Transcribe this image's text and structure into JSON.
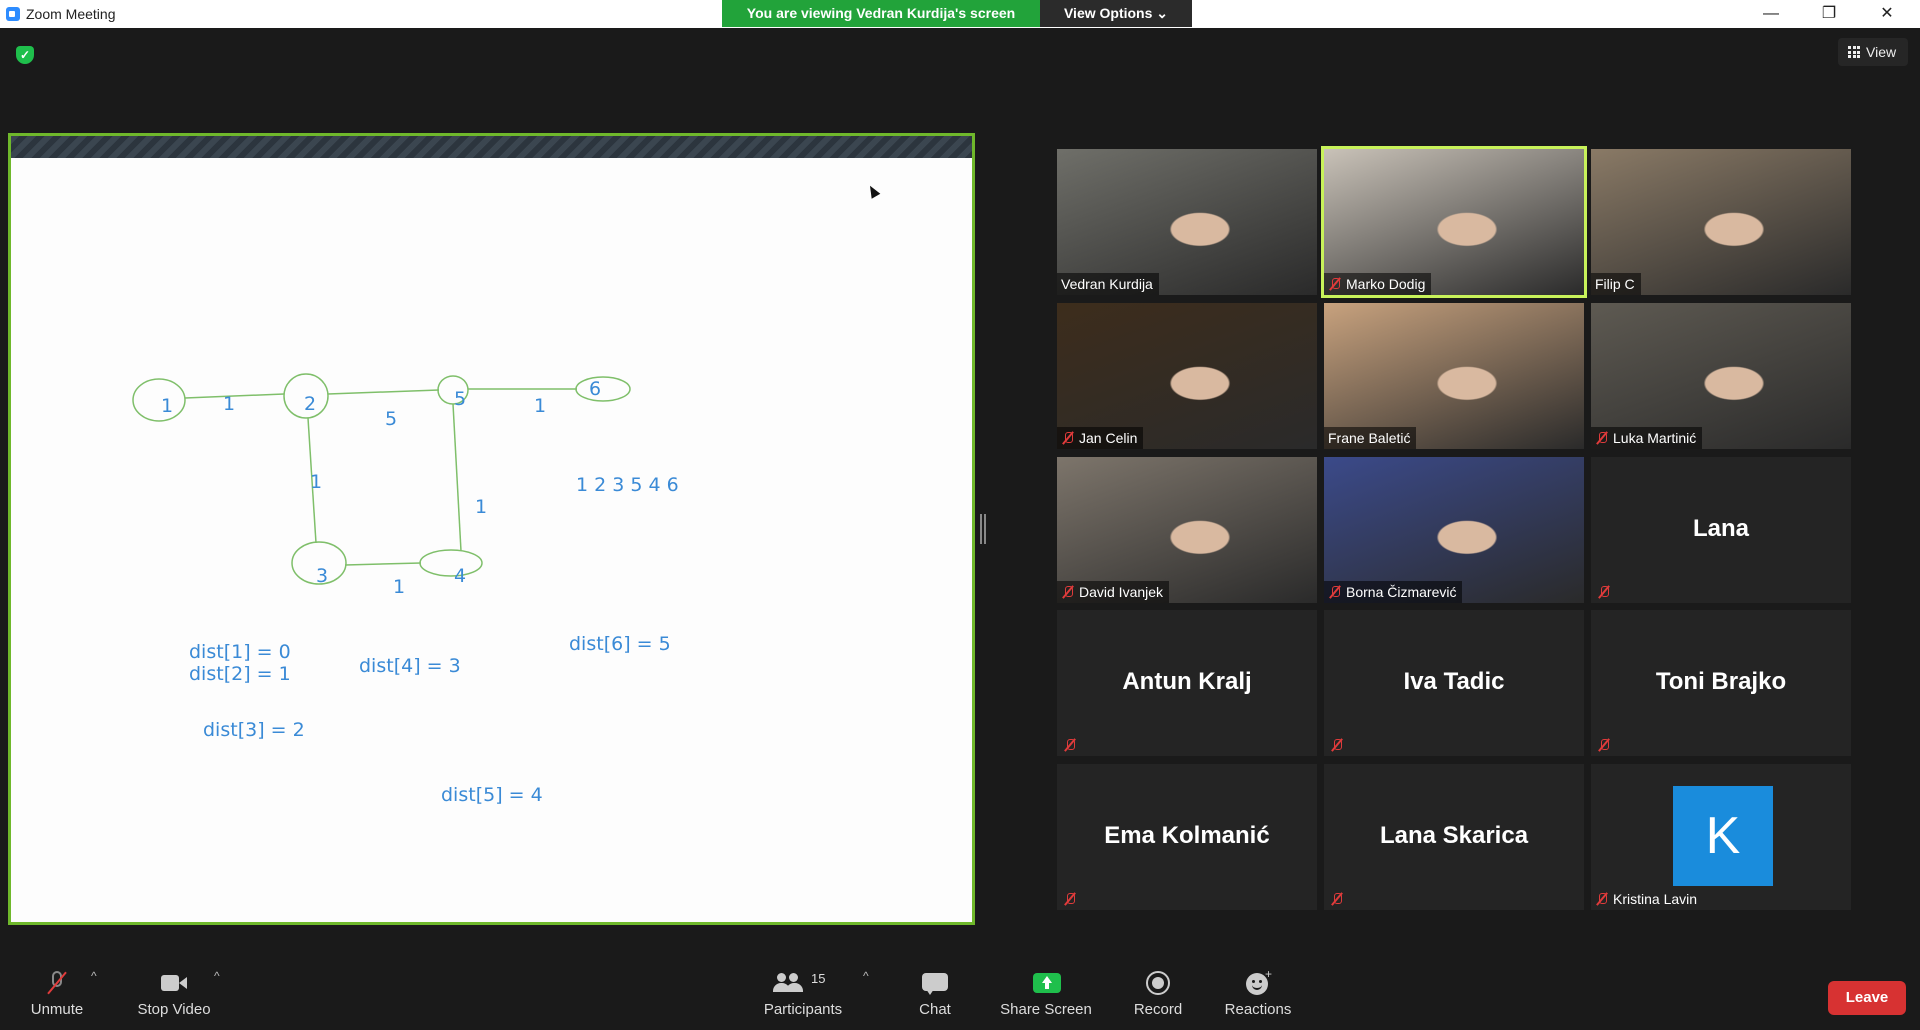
{
  "window": {
    "title": "Zoom Meeting",
    "banner": "You are viewing Vedran Kurdija's screen",
    "view_options": "View Options",
    "minimize": "—",
    "restore": "❐",
    "close": "✕"
  },
  "top": {
    "view_label": "View"
  },
  "whiteboard": {
    "nodes": [
      "1",
      "2",
      "5",
      "6",
      "3",
      "4"
    ],
    "edge_weights": [
      "1",
      "5",
      "1",
      "1",
      "1",
      "1"
    ],
    "order_text": "1 2 3 5 4 6",
    "dist": [
      "dist[1] = 0",
      "dist[2] = 1",
      "dist[4] = 3",
      "dist[6] = 5",
      "dist[3] = 2",
      "dist[5] = 4"
    ]
  },
  "participants": [
    {
      "name": "Vedran Kurdija",
      "muted": false,
      "video": true,
      "bg": "#6f6f69"
    },
    {
      "name": "Marko Dodig",
      "muted": true,
      "video": true,
      "bg": "#c9c2b8",
      "active": true
    },
    {
      "name": "Filip C",
      "muted": false,
      "video": true,
      "bg": "#8a7a66"
    },
    {
      "name": "Jan Celin",
      "muted": true,
      "video": true,
      "bg": "#3d2d1c"
    },
    {
      "name": "Frane Baletić",
      "muted": false,
      "video": true,
      "bg": "#c8a27e"
    },
    {
      "name": "Luka Martinić",
      "muted": true,
      "video": true,
      "bg": "#5e5a52"
    },
    {
      "name": "David Ivanjek",
      "muted": true,
      "video": true,
      "bg": "#7d756b"
    },
    {
      "name": "Borna Čizmarević",
      "muted": true,
      "video": true,
      "bg": "#3b4a8a"
    },
    {
      "name": "Lana",
      "muted": true,
      "video": false
    },
    {
      "name": "Antun Kralj",
      "muted": true,
      "video": false
    },
    {
      "name": "Iva Tadic",
      "muted": true,
      "video": false
    },
    {
      "name": "Toni Brajko",
      "muted": true,
      "video": false
    },
    {
      "name": "Ema Kolmanić",
      "muted": true,
      "video": false
    },
    {
      "name": "Lana Skarica",
      "muted": true,
      "video": false
    },
    {
      "name": "Kristina Lavin",
      "muted": true,
      "video": false,
      "avatar": "K"
    }
  ],
  "toolbar": {
    "unmute": "Unmute",
    "stop_video": "Stop Video",
    "participants": "Participants",
    "participants_count": "15",
    "chat": "Chat",
    "share_screen": "Share Screen",
    "record": "Record",
    "reactions": "Reactions",
    "leave": "Leave"
  },
  "colors": {
    "banner_green": "#22a33a",
    "share_border": "#6fb82b",
    "active_speaker": "#c8f25a",
    "leave_red": "#d73232",
    "share_screen_green": "#1fbf4c",
    "ink_blue": "#3a8ad6",
    "graph_green": "#7fbf6a"
  }
}
